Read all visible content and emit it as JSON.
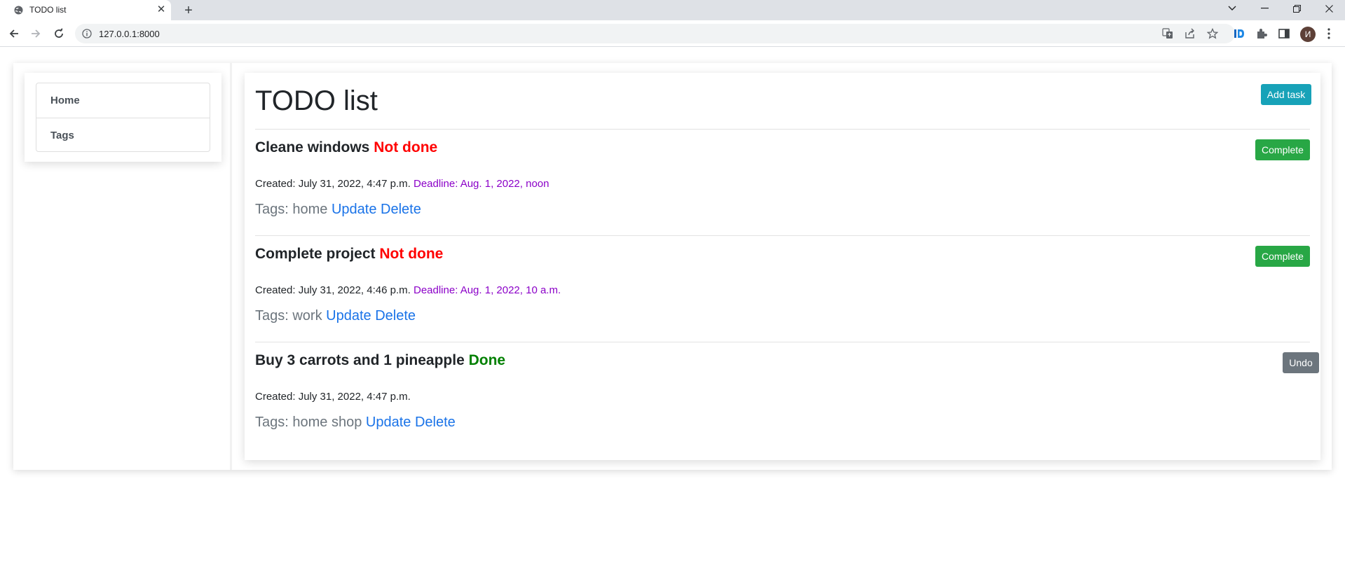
{
  "browser": {
    "tab_title": "TODO list",
    "url": "127.0.0.1:8000",
    "profile_initial": "И"
  },
  "sidebar": {
    "items": [
      {
        "label": "Home"
      },
      {
        "label": "Tags"
      }
    ]
  },
  "main": {
    "title": "TODO list",
    "add_task_label": "Add task"
  },
  "tasks": [
    {
      "title": "Cleane windows",
      "status": "Not done",
      "created": "Created: July 31, 2022, 4:47 p.m.",
      "deadline": "Deadline: Aug. 1, 2022, noon",
      "tags": "Tags: home",
      "update_label": "Update",
      "delete_label": "Delete",
      "action_label": "Complete"
    },
    {
      "title": "Complete project",
      "status": "Not done",
      "created": "Created: July 31, 2022, 4:46 p.m.",
      "deadline": "Deadline: Aug. 1, 2022, 10 a.m.",
      "tags": "Tags: work",
      "update_label": "Update",
      "delete_label": "Delete",
      "action_label": "Complete"
    },
    {
      "title": "Buy 3 carrots and 1 pineapple",
      "status": "Done",
      "created": "Created: July 31, 2022, 4:47 p.m.",
      "tags": "Tags: home shop",
      "update_label": "Update",
      "delete_label": "Delete",
      "action_label": "Undo"
    }
  ],
  "colors": {
    "not_done": "#ff0000",
    "done": "#008000",
    "deadline": "#8b00c8",
    "link": "#1a73e8",
    "add_task_button": "#17a2b8",
    "complete_button": "#28a745",
    "undo_button": "#6c757d"
  }
}
